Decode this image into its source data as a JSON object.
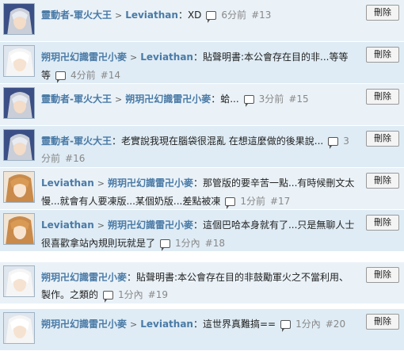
{
  "delete_label": "刪除",
  "rows": [
    {
      "avatar": "avatar-silver-hair",
      "from": "靈動者-軍火大王",
      "to": "Leviathan",
      "message": "：XD",
      "time": "6分前",
      "num": "#13"
    },
    {
      "avatar": "avatar-white-hair",
      "from": "朔玥卍幻識雷卍小麥",
      "to": "Leviathan",
      "message": "：貼聲明書:本公會存在目的非...等等等",
      "time": "4分前",
      "num": "#14"
    },
    {
      "avatar": "avatar-silver-hair",
      "from": "靈動者-軍火大王",
      "to": "朔玥卍幻識雷卍小麥",
      "message": "：蛤...",
      "time": "3分前",
      "num": "#15"
    },
    {
      "avatar": "avatar-silver-hair",
      "from": "靈動者-軍火大王",
      "to": "",
      "message": "：老實說我現在腦袋很混亂 在想這麼做的後果說...",
      "time": "3分前",
      "num": "#16"
    },
    {
      "avatar": "avatar-brown-hair",
      "from": "Leviathan",
      "to": "朔玥卍幻識雷卍小麥",
      "message": "：那管版的要辛苦一點...有時候刪文太慢...就會有人要凍版...某個奶版...差點被凍",
      "time": "1分前",
      "num": "#17"
    },
    {
      "avatar": "avatar-brown-hair",
      "from": "Leviathan",
      "to": "朔玥卍幻識雷卍小麥",
      "message": "：這個巴哈本身就有了...只是無聊人士很喜歡拿站內規則玩就是了",
      "time": "1分內",
      "num": "#18"
    },
    {
      "avatar": "avatar-white-hair",
      "from": "朔玥卍幻識雷卍小麥",
      "to": "",
      "message": "：貼聲明書:本公會存在目的非鼓勵軍火之不當利用、製作。之類的",
      "time": "1分內",
      "num": "#19"
    },
    {
      "avatar": "avatar-white-hair",
      "from": "朔玥卍幻識雷卍小麥",
      "to": "Leviathan",
      "message": "：這世界真難搞==",
      "time": "1分內",
      "num": "#20"
    }
  ]
}
